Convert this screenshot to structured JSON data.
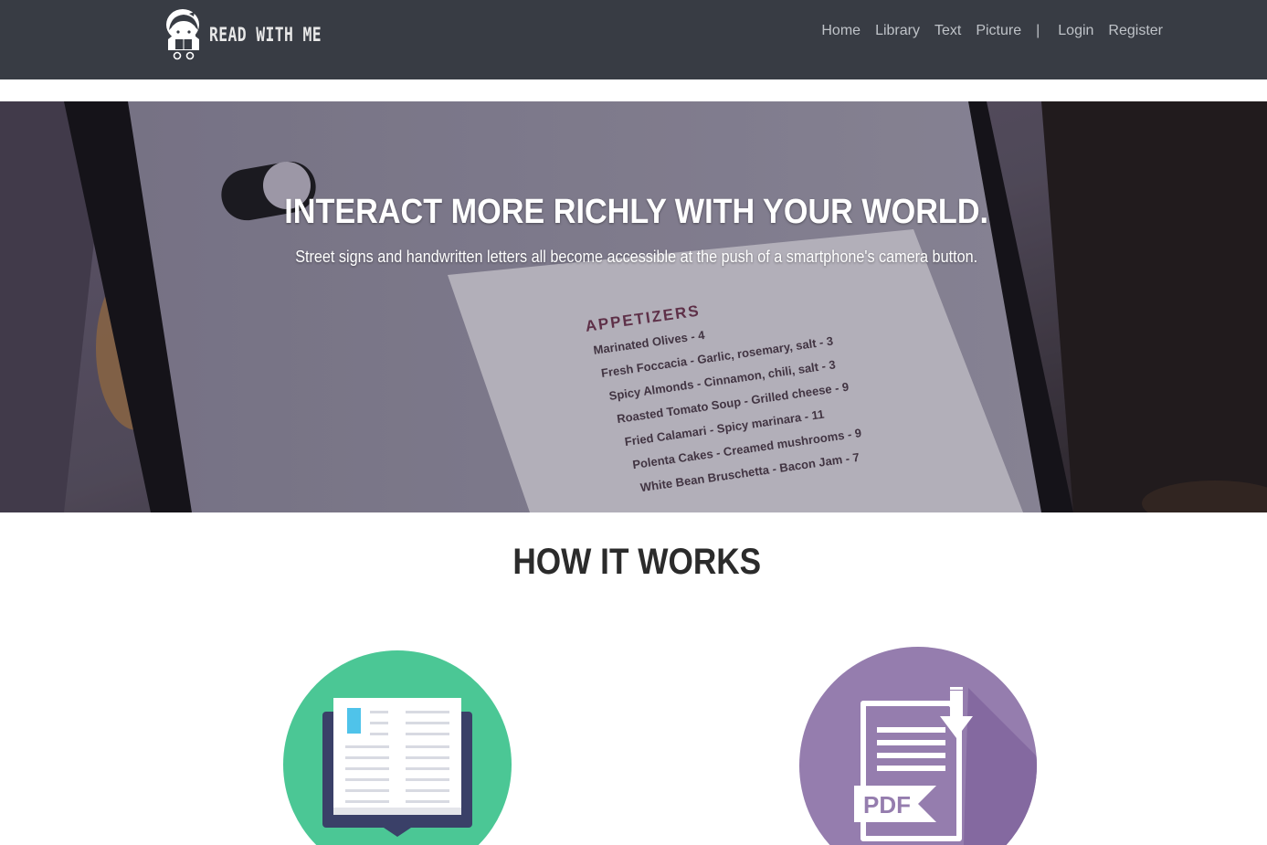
{
  "brand": {
    "name": "READ WITH ME",
    "logo_icon": "girl-reading-logo-icon"
  },
  "nav": {
    "links": [
      "Home",
      "Library",
      "Text",
      "Picture"
    ],
    "separator": "|",
    "auth_links": [
      "Login",
      "Register"
    ]
  },
  "hero": {
    "title": "INTERACT MORE RICHLY WITH YOUR WORLD.",
    "subtitle": "Street signs and handwritten letters all become accessible at the push of a smartphone's camera button.",
    "image_menu": {
      "heading": "APPETIZERS",
      "items": [
        "Marinated Olives - 4",
        "Fresh Foccacia - Garlic, rosemary, salt - 3",
        "Spicy Almonds - Cinnamon, chili, salt - 3",
        "Roasted Tomato Soup - Grilled cheese - 9",
        "Fried Calamari - Spicy marinara - 11",
        "Polenta Cakes - Creamed mushrooms - 9",
        "White Bean Bruschetta - Bacon Jam - 7"
      ]
    }
  },
  "how_it_works": {
    "title": "HOW IT WORKS",
    "features": [
      {
        "icon": "open-book-icon",
        "color": "#4bc795"
      },
      {
        "icon": "pdf-download-icon",
        "color": "#957dae",
        "badge": "PDF"
      }
    ]
  },
  "colors": {
    "navbar": "#383c44",
    "nav_text": "#bfc3c8",
    "book_circle": "#4bc795",
    "pdf_circle": "#957dae"
  }
}
